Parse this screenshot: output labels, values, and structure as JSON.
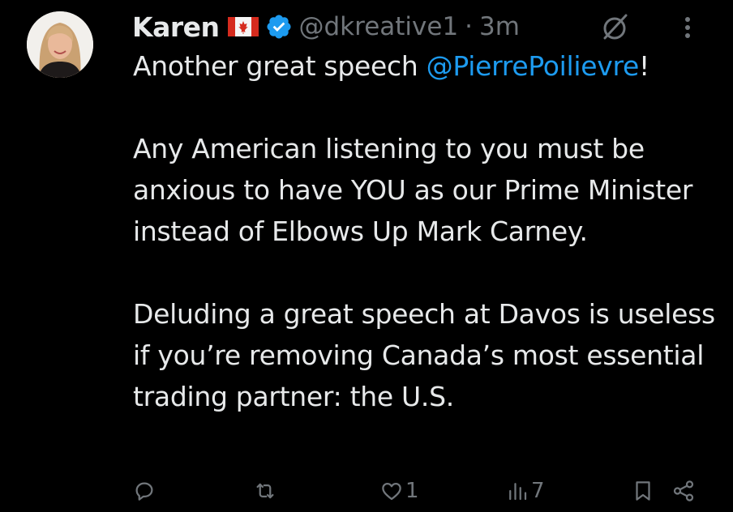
{
  "tweet": {
    "author_name": "Karen",
    "handle": "@dkreative1",
    "separator": "·",
    "time": "3m",
    "text_intro": "Another great speech ",
    "mention": "@PierrePoilievre",
    "text_intro_end": "!",
    "paragraph2": "Any American listening to you must be anxious to have YOU as our Prime Minister instead of Elbows Up Mark Carney.",
    "paragraph3": "Deluding a great speech at Davos is useless if you’re removing Canada’s most essential trading partner: the U.S."
  },
  "actions": {
    "reply_count": "",
    "retweet_count": "",
    "like_count": "1",
    "views_count": "7"
  },
  "icons": {
    "flag": "canada-flag-icon",
    "verified": "verified-badge-icon",
    "grok": "grok-icon",
    "more": "more-icon",
    "reply": "reply-icon",
    "retweet": "retweet-icon",
    "like": "like-icon",
    "views": "views-icon",
    "bookmark": "bookmark-icon",
    "share": "share-icon"
  },
  "colors": {
    "background": "#000000",
    "text": "#e7e9ea",
    "muted": "#71767b",
    "link": "#1d9bf0",
    "verified": "#1d9bf0"
  }
}
